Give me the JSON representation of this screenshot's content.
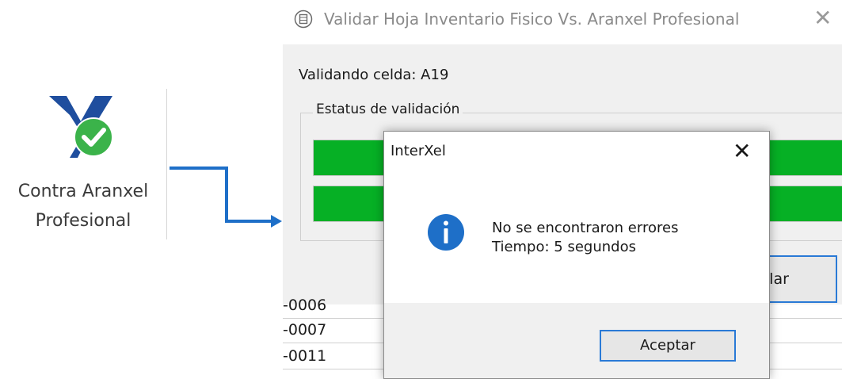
{
  "ribbon": {
    "label_line1": "Contra Aranxel",
    "label_line2": "Profesional",
    "icon": "interxel-check-icon",
    "colors": {
      "logo_blue": "#1f4e9e",
      "check_green": "#3bb34a"
    }
  },
  "validation_window": {
    "title": "Validar Hoja Inventario Fisico Vs. Aranxel Profesional",
    "close_glyph": "✕",
    "status_text": "Validando celda: A19",
    "group_label": "Estatus de validación",
    "progress": [
      1.0,
      1.0
    ],
    "cancel_label": "ncelar",
    "sheet_rows": [
      "-0006",
      "-0007",
      "-0011"
    ],
    "colors": {
      "progress": "#06b025"
    }
  },
  "message_box": {
    "title": "InterXel",
    "close_glyph": "✕",
    "icon": "info-icon",
    "line1": "No se encontraron errores",
    "line2": "Tiempo: 5 segundos",
    "ok_label": "Aceptar",
    "colors": {
      "info": "#1e6fc8",
      "focus_border": "#2a7ad6"
    }
  },
  "connector": {
    "color": "#1e6fc8"
  }
}
